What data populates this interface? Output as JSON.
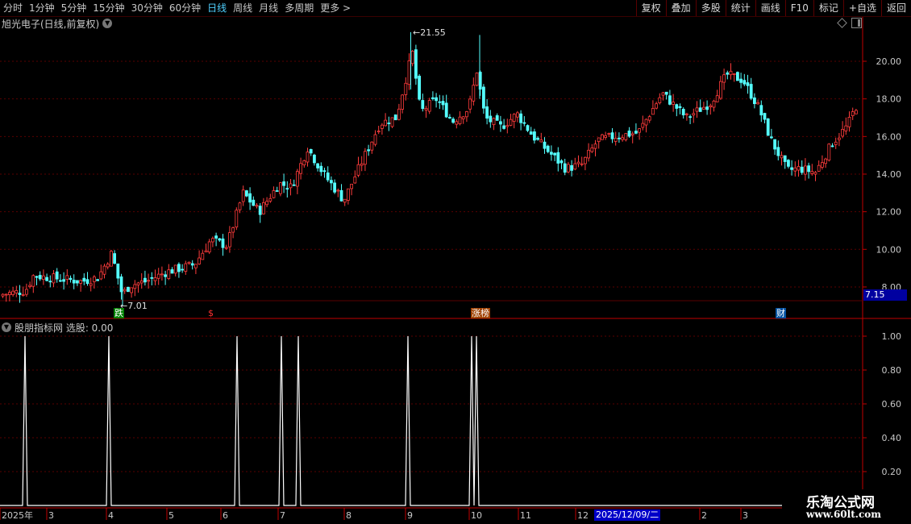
{
  "toolbar": {
    "periods": [
      "分时",
      "1分钟",
      "5分钟",
      "15分钟",
      "30分钟",
      "60分钟",
      "日线",
      "周线",
      "月线",
      "多周期",
      "更多 >"
    ],
    "active_period": "日线",
    "buttons": [
      "复权",
      "叠加",
      "多股",
      "统计",
      "画线",
      "F10",
      "标记",
      "+自选",
      "返回"
    ]
  },
  "main": {
    "title": "旭光电子(日线,前复权)",
    "last_price": "7.15",
    "high_label": "21.55",
    "low_label": "7.01",
    "y_ticks": [
      "20.00",
      "18.00",
      "16.00",
      "14.00",
      "12.00",
      "10.00",
      "8.00"
    ],
    "markers": [
      {
        "text": "跌",
        "color": "#ffffff",
        "bg": "#008000"
      },
      {
        "text": "$",
        "color": "#ff3030",
        "bg": "transparent"
      },
      {
        "text": "涨榜",
        "color": "#ffffff",
        "bg": "#a04000"
      },
      {
        "text": "财",
        "color": "#ffffff",
        "bg": "#0050a0"
      }
    ]
  },
  "indicator": {
    "title": "股朋指标网 选股: 0.00",
    "y_ticks": [
      "1.00",
      "0.80",
      "0.60",
      "0.40",
      "0.20"
    ]
  },
  "date_axis": {
    "labels": [
      "2025年",
      "3",
      "4",
      "5",
      "6",
      "7",
      "8",
      "9",
      "10",
      "11",
      "12",
      "2",
      "3"
    ],
    "highlight": "2025/12/09/二"
  },
  "watermark": {
    "line1": "乐淘公式网",
    "line2": "www.60lt.com"
  },
  "colors": {
    "up": "#ff3c3c",
    "down": "#54ffff",
    "grid": "#5a0000",
    "axis": "#c00000"
  }
}
